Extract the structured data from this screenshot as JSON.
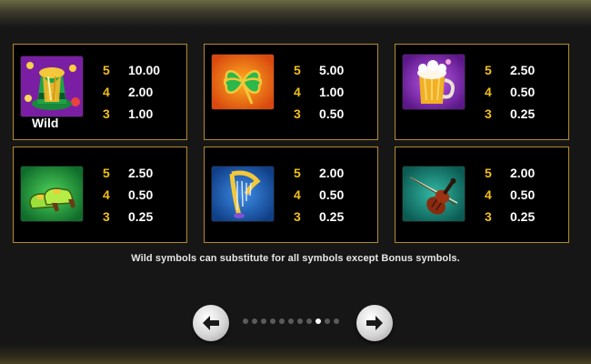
{
  "paytable": {
    "cards": [
      {
        "symbol": "wild-hat-icon",
        "label": "Wild",
        "pays": [
          {
            "count": "5",
            "value": "10.00"
          },
          {
            "count": "4",
            "value": "2.00"
          },
          {
            "count": "3",
            "value": "1.00"
          }
        ]
      },
      {
        "symbol": "clover-icon",
        "pays": [
          {
            "count": "5",
            "value": "5.00"
          },
          {
            "count": "4",
            "value": "1.00"
          },
          {
            "count": "3",
            "value": "0.50"
          }
        ]
      },
      {
        "symbol": "beer-mug-icon",
        "pays": [
          {
            "count": "5",
            "value": "2.50"
          },
          {
            "count": "4",
            "value": "0.50"
          },
          {
            "count": "3",
            "value": "0.25"
          }
        ]
      },
      {
        "symbol": "shoes-icon",
        "pays": [
          {
            "count": "5",
            "value": "2.50"
          },
          {
            "count": "4",
            "value": "0.50"
          },
          {
            "count": "3",
            "value": "0.25"
          }
        ]
      },
      {
        "symbol": "harp-icon",
        "pays": [
          {
            "count": "5",
            "value": "2.00"
          },
          {
            "count": "4",
            "value": "0.50"
          },
          {
            "count": "3",
            "value": "0.25"
          }
        ]
      },
      {
        "symbol": "violin-icon",
        "pays": [
          {
            "count": "5",
            "value": "2.00"
          },
          {
            "count": "4",
            "value": "0.50"
          },
          {
            "count": "3",
            "value": "0.25"
          }
        ]
      }
    ],
    "note": "Wild symbols can substitute for all symbols except Bonus symbols."
  },
  "pagination": {
    "prev_icon": "arrow-left-icon",
    "next_icon": "arrow-right-icon",
    "total_pages": 11,
    "current_page": 8
  },
  "colors": {
    "border": "#b38b2a",
    "count": "#f1bf1a",
    "value": "#ffffff",
    "background": "#000000"
  }
}
